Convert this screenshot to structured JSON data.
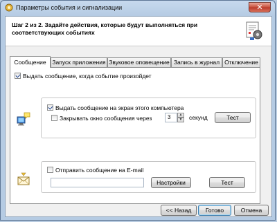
{
  "window": {
    "title": "Параметры события и сигнализации",
    "close_label": "✕"
  },
  "header": {
    "text": "Шаг 2 из 2. Задайте действия, которые будут выполняться при соответствующих событиях",
    "icon": "document-gear-icon"
  },
  "tabs": [
    {
      "label": "Сообщение",
      "active": true
    },
    {
      "label": "Запуск приложения",
      "active": false
    },
    {
      "label": "Звуковое оповещение",
      "active": false
    },
    {
      "label": "Запись в журнал",
      "active": false
    },
    {
      "label": "Отключение",
      "active": false
    }
  ],
  "message_tab": {
    "main_checkbox": {
      "label": "Выдать сообщение, когда событие произойдет",
      "checked": true
    },
    "screen_group": {
      "icon": "computer-message-icon",
      "show_checkbox": {
        "label": "Выдать сообщение на экран этого компьютера",
        "checked": true
      },
      "close_checkbox": {
        "label": "Закрывать окно сообщения через",
        "checked": false
      },
      "seconds_value": "3",
      "seconds_label": "секунд",
      "test_button": "Тест"
    },
    "email_group": {
      "icon": "envelope-icon",
      "email_checkbox": {
        "label": "Отправить сообщение на E-mail",
        "checked": false
      },
      "email_value": "",
      "settings_button": "Настройки",
      "test_button": "Тест"
    }
  },
  "footer": {
    "back_button": "<< Назад",
    "finish_button": "Готово",
    "cancel_button": "Отмена"
  },
  "colors": {
    "frame": "#b5cbe3",
    "close": "#c7503c",
    "default_button_border": "#3c7fb1"
  }
}
